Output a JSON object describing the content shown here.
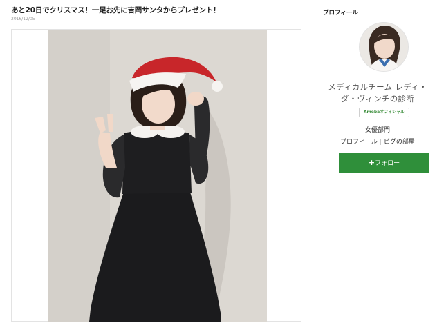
{
  "post": {
    "title": "あと20日でクリスマス！一足お先に吉岡サンタからプレゼント！",
    "date": "2016/12/05"
  },
  "sidebar": {
    "heading": "プロフィール",
    "avatar_icon": "profile-avatar-photo",
    "blog_name": "メディカルチーム レディ・ダ・ヴィンチの診断",
    "badge": "Amebaオフィシャル",
    "category": "女優部門",
    "links": {
      "profile": "プロフィール",
      "room": "ピグの部屋"
    },
    "follow": {
      "icon": "+",
      "label": "フォロー"
    }
  },
  "colors": {
    "accent": "#2f8f3a",
    "badge_text": "#3b8d3b"
  }
}
